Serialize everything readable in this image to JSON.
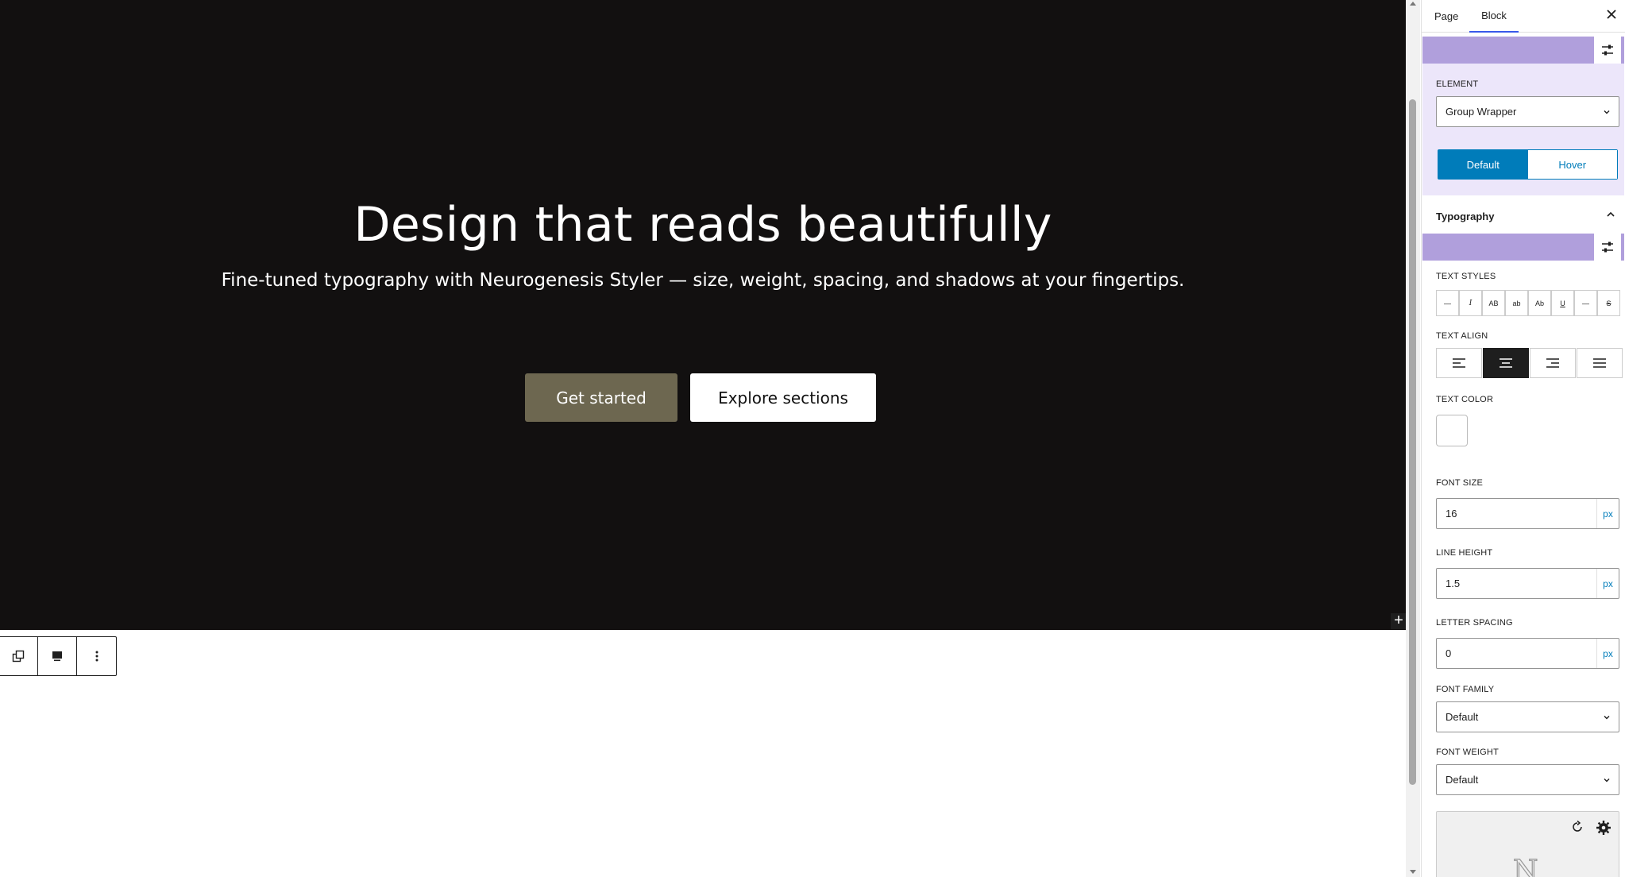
{
  "hero": {
    "title": "Design that reads beautifully",
    "subtitle": "Fine-tuned typography with Neurogenesis Styler — size, weight, spacing, and shadows at your fingertips.",
    "primary_button": "Get started",
    "secondary_button": "Explore sections",
    "background_color": "#121010",
    "primary_button_color": "#6d6750"
  },
  "block_toolbar": {
    "items": [
      "duplicate-icon",
      "block-type-icon",
      "more-options-icon"
    ]
  },
  "sidebar": {
    "tabs": {
      "page": "Page",
      "block": "Block"
    },
    "active_tab": "Block",
    "element": {
      "label": "ELEMENT",
      "value": "Group Wrapper"
    },
    "state_toggle": {
      "default": "Default",
      "hover": "Hover",
      "active": "Default"
    },
    "typography": {
      "title": "Typography",
      "text_styles_label": "TEXT STYLES",
      "text_styles": [
        "—",
        "I",
        "AB",
        "ab",
        "Ab",
        "U",
        "—",
        "S"
      ],
      "text_align_label": "TEXT ALIGN",
      "text_align_options": [
        "left",
        "center",
        "right",
        "justify"
      ],
      "text_align_active": "center",
      "text_color_label": "TEXT COLOR",
      "text_color_value": "#ffffff",
      "font_size_label": "FONT SIZE",
      "font_size_value": "16",
      "font_size_unit": "px",
      "line_height_label": "LINE HEIGHT",
      "line_height_value": "1.5",
      "line_height_unit": "px",
      "letter_spacing_label": "LETTER SPACING",
      "letter_spacing_value": "0",
      "letter_spacing_unit": "px",
      "font_family_label": "FONT FAMILY",
      "font_family_value": "Default",
      "font_weight_label": "FONT WEIGHT",
      "font_weight_value": "Default"
    },
    "accent_color": "#b09fdc",
    "panel_bg_color": "#ece6fa",
    "toggle_color": "#007cba"
  }
}
